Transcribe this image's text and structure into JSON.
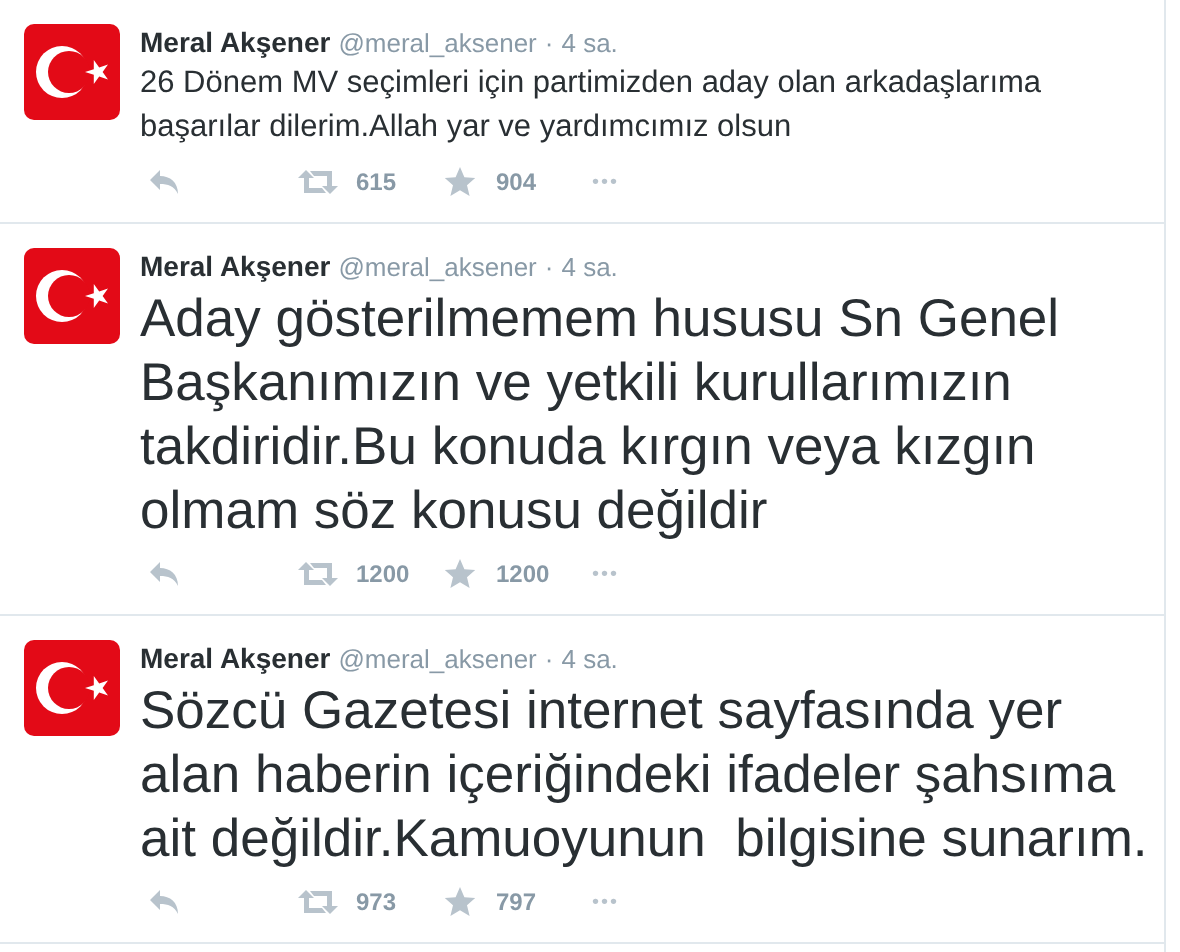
{
  "tweets": [
    {
      "name": "Meral Akşener",
      "handle": "@meral_aksener",
      "separator": "·",
      "time": "4 sa.",
      "kind": "short",
      "text": "26 Dönem MV seçimleri için partimizden aday olan arkadaşlarıma başarılar dilerim.Allah yar ve yardımcımız olsun",
      "retweets": "615",
      "favorites": "904",
      "more": "•••"
    },
    {
      "name": "Meral Akşener",
      "handle": "@meral_aksener",
      "separator": "·",
      "time": "4 sa.",
      "kind": "large",
      "text": "Aday gösterilmemem hususu Sn Genel Başkanımızın ve yetkili kurullarımızın takdiridir.Bu konuda kırgın veya kızgın olmam söz konusu değildir",
      "retweets": "1200",
      "favorites": "1200",
      "more": "•••"
    },
    {
      "name": "Meral Akşener",
      "handle": "@meral_aksener",
      "separator": "·",
      "time": "4 sa.",
      "kind": "large",
      "text": "Sözcü Gazetesi internet sayfasında yer alan haberin içeriğindeki ifadeler şahsıma ait değildir.Kamuoyunun  bilgisine sunarım.",
      "retweets": "973",
      "favorites": "797",
      "more": "•••"
    }
  ]
}
